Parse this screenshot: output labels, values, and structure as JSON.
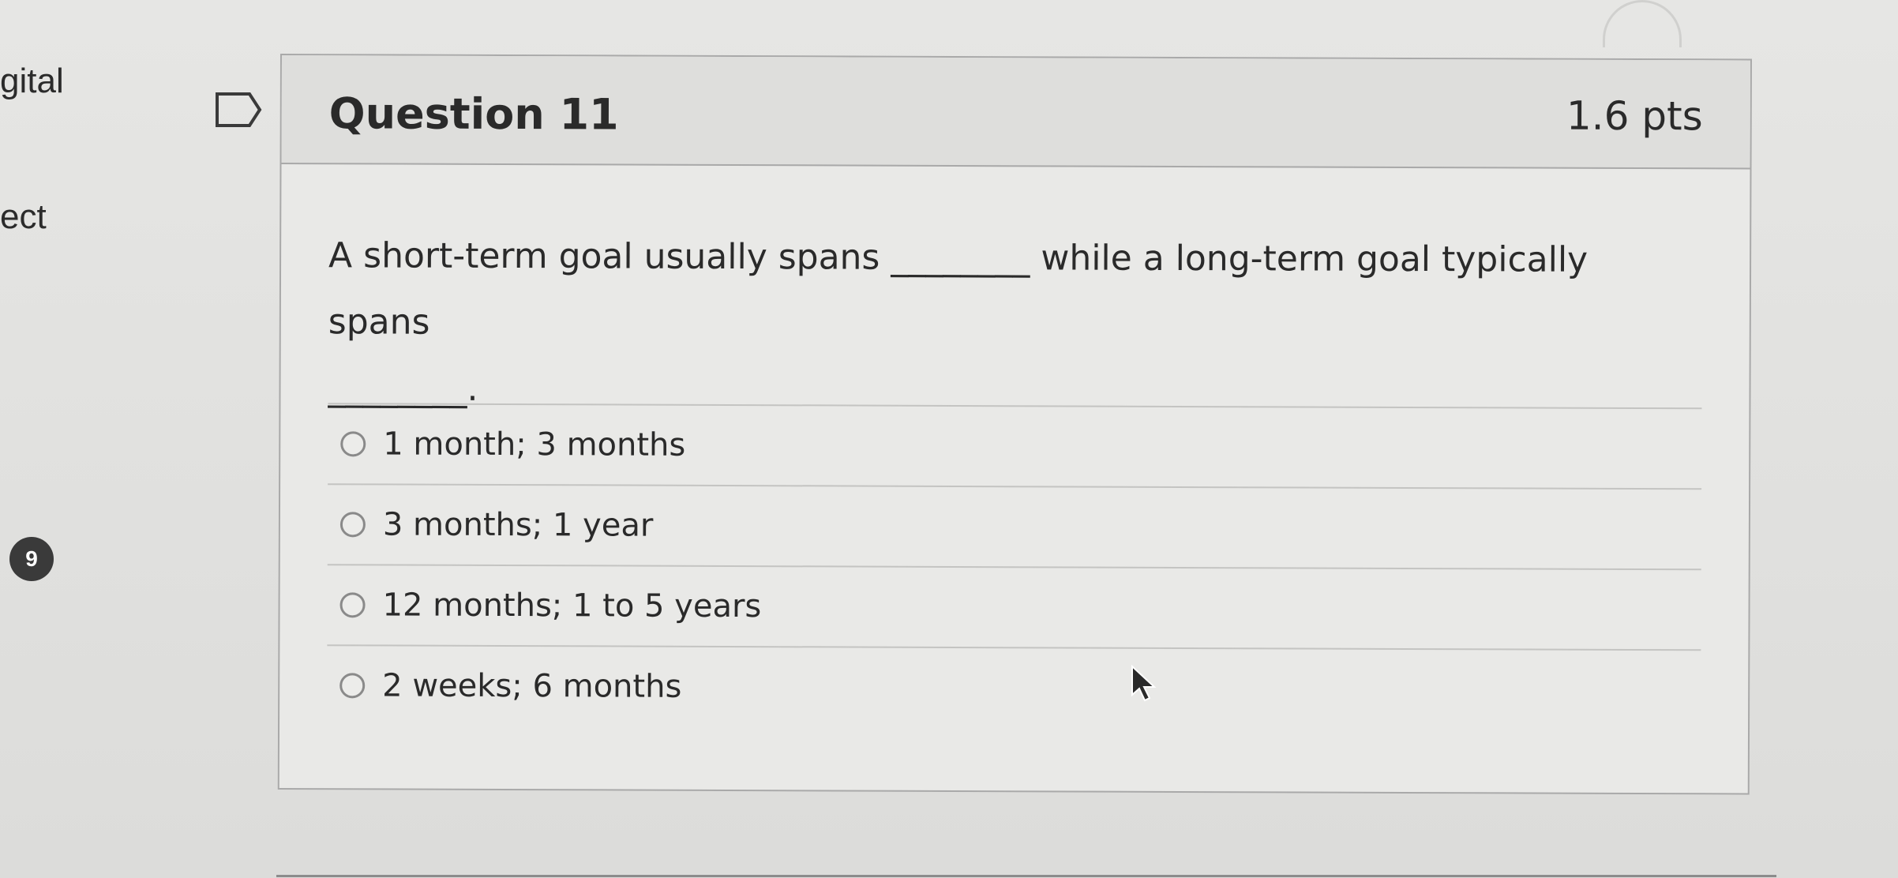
{
  "left_nav": {
    "fragment_1": "gital",
    "fragment_2": "ect",
    "badge": "9"
  },
  "question": {
    "title": "Question 11",
    "points": "1.6 pts",
    "text_line_1": "A short-term goal usually spans ________ while a long-term goal typically spans",
    "text_line_2": "________.",
    "answers": [
      {
        "label": "1 month; 3 months"
      },
      {
        "label": "3 months; 1 year"
      },
      {
        "label": "12 months; 1 to 5 years"
      },
      {
        "label": "2 weeks; 6 months"
      }
    ]
  },
  "icons": {
    "flag": "flag-outline-icon",
    "cursor": "mouse-pointer-icon"
  }
}
